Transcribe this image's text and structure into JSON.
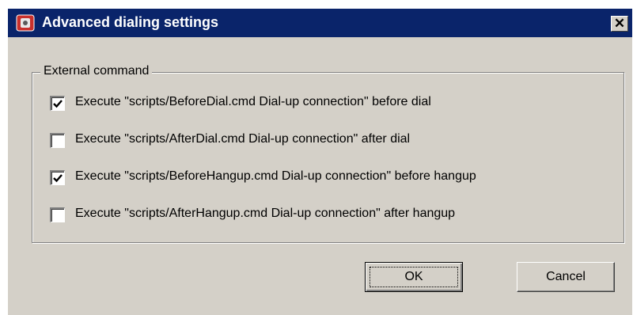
{
  "window": {
    "title": "Advanced dialing settings",
    "close_glyph": "✕",
    "icon": "app-phone-icon",
    "title_bar_color": "#0a246a"
  },
  "group": {
    "legend": "External command",
    "options": [
      {
        "label": "Execute \"scripts/BeforeDial.cmd Dial-up connection\" before dial",
        "checked": true
      },
      {
        "label": "Execute \"scripts/AfterDial.cmd Dial-up connection\" after dial",
        "checked": false
      },
      {
        "label": "Execute \"scripts/BeforeHangup.cmd Dial-up connection\" before hangup",
        "checked": true
      },
      {
        "label": "Execute \"scripts/AfterHangup.cmd Dial-up connection\" after hangup",
        "checked": false
      }
    ]
  },
  "buttons": {
    "ok_label": "OK",
    "cancel_label": "Cancel"
  }
}
